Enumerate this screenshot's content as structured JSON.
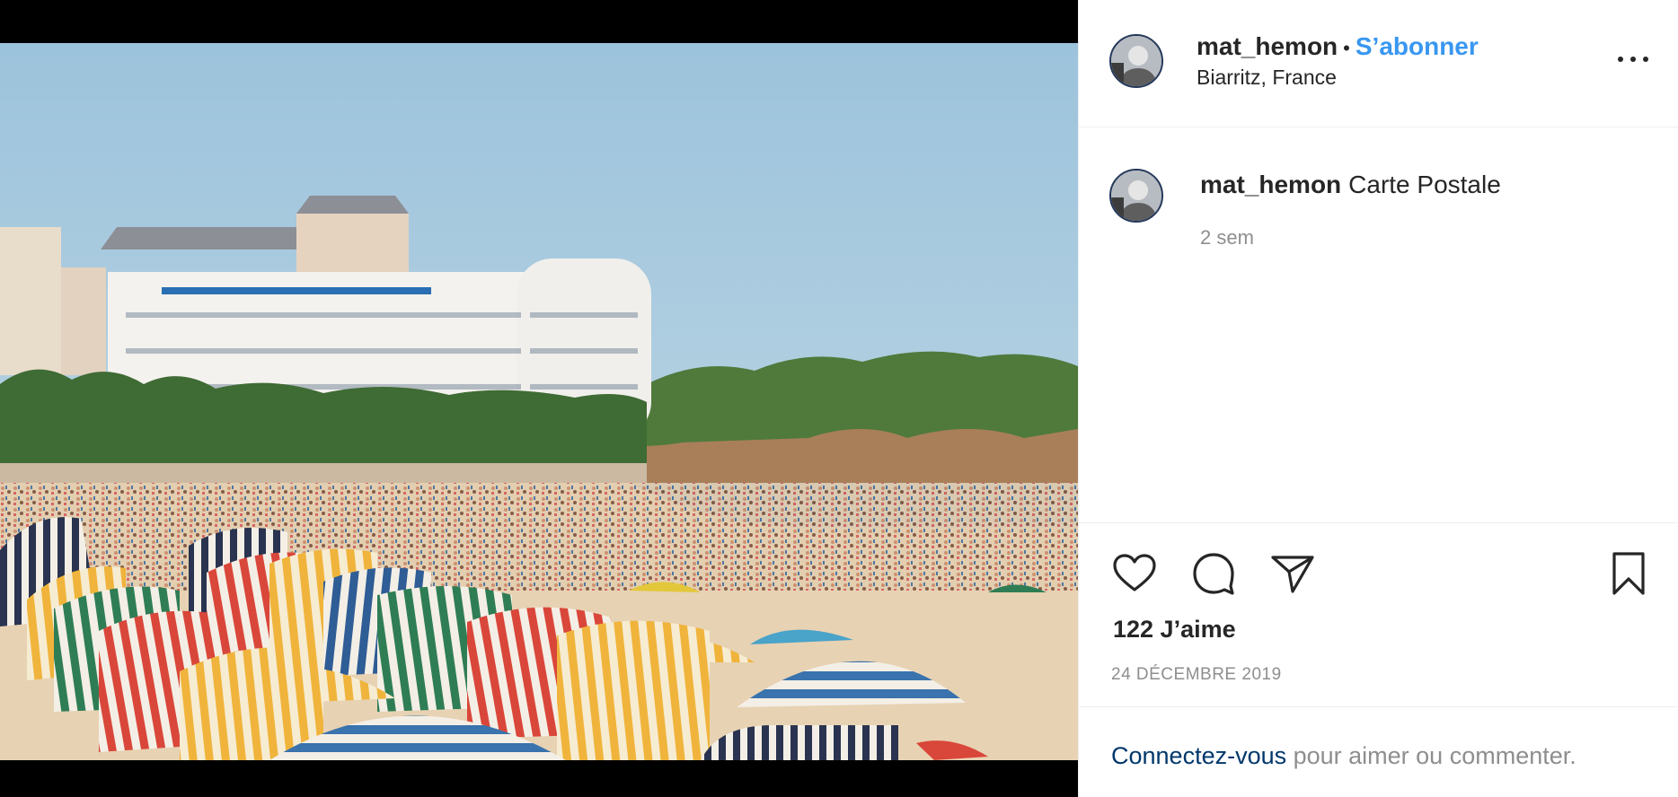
{
  "post": {
    "username": "mat_hemon",
    "separator": "•",
    "follow_label": "S’abonner",
    "location": "Biarritz, France",
    "more_icon": "more-horizontal-icon"
  },
  "caption": {
    "username": "mat_hemon",
    "text": "Carte Postale",
    "time_ago": "2 sem"
  },
  "actions": {
    "icons": [
      "heart-icon",
      "comment-icon",
      "paper-plane-icon",
      "bookmark-icon"
    ],
    "likes": "122 J’aime",
    "date": "24 DÉCEMBRE 2019"
  },
  "login": {
    "link": "Connectez-vous",
    "rest": " pour aimer ou commenter."
  },
  "colors": {
    "accent": "#3897f0",
    "link_dark": "#00376b",
    "text": "#262626",
    "muted": "#8e8e8e",
    "border": "#efefef"
  }
}
